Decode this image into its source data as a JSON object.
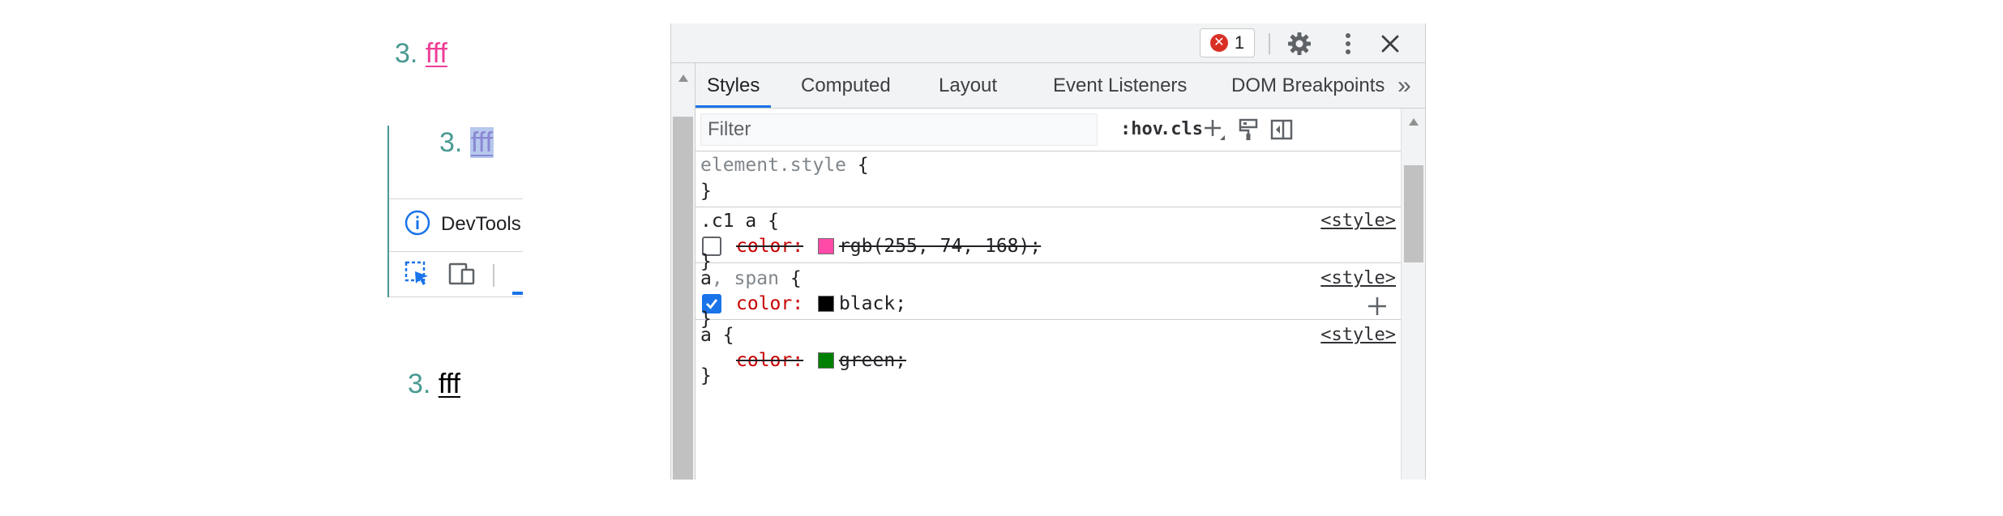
{
  "page_preview": {
    "line1": {
      "number": "3.",
      "link": "fff"
    },
    "line2": {
      "number": "3.",
      "link": "fff"
    },
    "mini_devtools": {
      "info_text": "DevTools"
    },
    "line3": {
      "number": "3.",
      "link": "fff"
    }
  },
  "devtools": {
    "error_badge": {
      "count": "1"
    },
    "icons": {
      "settings": "gear-icon",
      "more": "kebab-menu-icon",
      "close": "close-icon"
    },
    "tabs": [
      {
        "label": "Styles",
        "active": true
      },
      {
        "label": "Computed",
        "active": false
      },
      {
        "label": "Layout",
        "active": false
      },
      {
        "label": "Event Listeners",
        "active": false
      },
      {
        "label": "DOM Breakpoints",
        "active": false
      }
    ],
    "more_tabs": "»",
    "filter": {
      "placeholder": "Filter",
      "value": ""
    },
    "toolbar": {
      "hov": ":hov",
      "cls": ".cls"
    },
    "rules": {
      "element_style": {
        "selector": "element.style",
        "open": "{",
        "close": "}"
      },
      "c1a": {
        "selector": ".c1 a",
        "open": "{",
        "source": "<style>",
        "property": "color:",
        "value": "rgb(255, 74, 168);",
        "swatch": "#ff4aa8",
        "enabled": false,
        "close": "}"
      },
      "a_span": {
        "selector_main": "a",
        "selector_rest": ", span",
        "open": "{",
        "source": "<style>",
        "property": "color:",
        "value": "black;",
        "swatch": "#000000",
        "enabled": true,
        "close": "}"
      },
      "a": {
        "selector": "a",
        "open": "{",
        "source": "<style>",
        "property": "color:",
        "value": "green;",
        "swatch": "#008000",
        "overridden": true,
        "close": "}"
      }
    }
  },
  "colors": {
    "accent": "#1a73e8",
    "error": "#d93025",
    "css_property": "#c80000",
    "list_number": "#4a9a93",
    "pink_link": "#ee3e97"
  }
}
